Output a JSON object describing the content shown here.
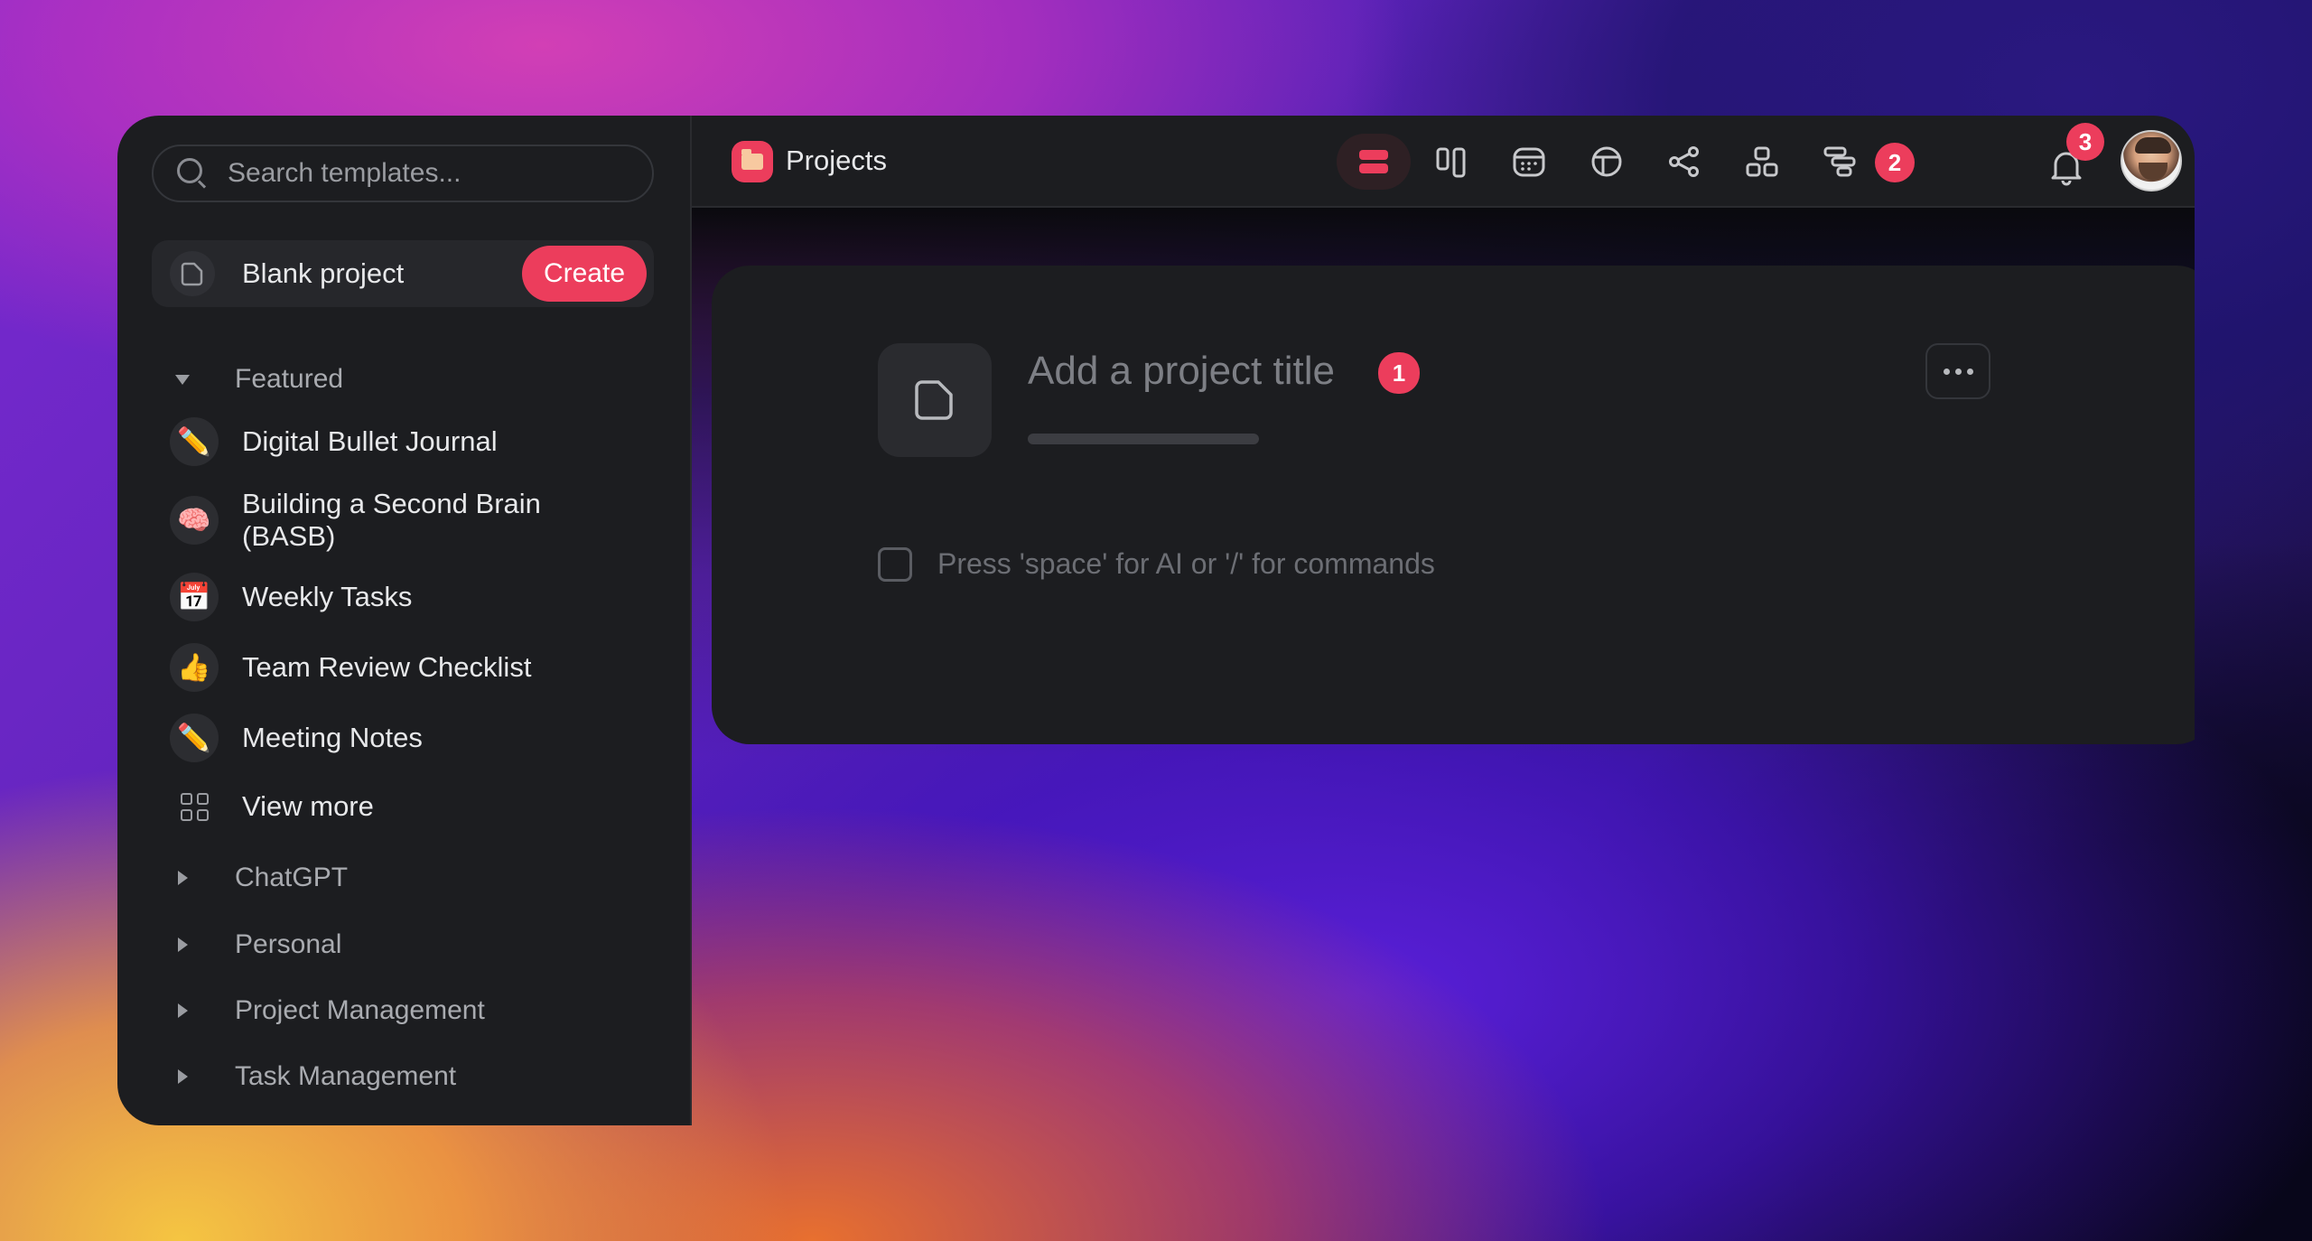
{
  "sidebar": {
    "search_placeholder": "Search templates...",
    "blank_project": {
      "label": "Blank project",
      "create_label": "Create"
    },
    "featured": {
      "label": "Featured",
      "items": [
        {
          "emoji": "✏️",
          "label": "Digital Bullet Journal"
        },
        {
          "emoji": "🧠",
          "label": "Building a Second Brain (BASB)"
        },
        {
          "emoji": "📅",
          "label": "Weekly Tasks"
        },
        {
          "emoji": "👍",
          "label": "Team Review Checklist"
        },
        {
          "emoji": "✏️",
          "label": "Meeting Notes"
        }
      ],
      "view_more_label": "View more"
    },
    "categories": [
      {
        "label": "ChatGPT"
      },
      {
        "label": "Personal"
      },
      {
        "label": "Project Management"
      },
      {
        "label": "Task Management"
      }
    ]
  },
  "topbar": {
    "title": "Projects",
    "views": [
      "list-view",
      "board-view",
      "calendar-view",
      "table-view",
      "mindmap-view",
      "hierarchy-view",
      "gantt-view"
    ],
    "views_badge": "2",
    "notifications_badge": "3"
  },
  "editor": {
    "title_placeholder": "Add a project title",
    "title_badge": "1",
    "task_placeholder": "Press 'space' for AI or '/' for commands"
  },
  "colors": {
    "accent": "#ec3d5c",
    "panel": "#1c1d20"
  }
}
